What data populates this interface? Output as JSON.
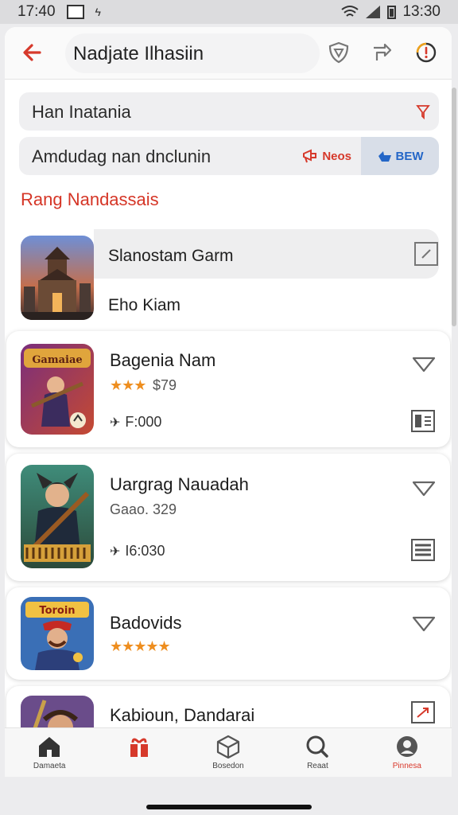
{
  "status_bar": {
    "time_left": "17:40",
    "time_right": "13:30"
  },
  "header": {
    "title": "Nadjate Ilhasiin"
  },
  "filters": {
    "dropdown_label": "Han Inatania",
    "toggle_label": "Amdudag nan dnclunin",
    "news_label": "Neos",
    "new_label": "BEW"
  },
  "section": {
    "title": "Rang Nandassais"
  },
  "featured": {
    "title": "Slanostam Garm",
    "subtitle": "Eho Kiam"
  },
  "games": [
    {
      "title": "Bagenia Nam",
      "rating": 3,
      "rating_text": "$79",
      "stat": "F:000"
    },
    {
      "title": "Uargrag Nauadah",
      "subtitle": "Gaao. 329",
      "stat": "I6:030"
    },
    {
      "title": "Badovids",
      "rating": 5
    },
    {
      "title": "Kabioun, Dandarai"
    }
  ],
  "thumb_labels": {
    "game1": "Gamaiae",
    "game3": "Toroin"
  },
  "nav": [
    {
      "label": "Damaeta",
      "icon": "home-icon"
    },
    {
      "label": "",
      "icon": "gift-icon"
    },
    {
      "label": "Bosedon",
      "icon": "cube-icon"
    },
    {
      "label": "Reaat",
      "icon": "search-icon"
    },
    {
      "label": "Pinnesa",
      "icon": "profile-icon"
    }
  ],
  "colors": {
    "accent": "#d6392b",
    "blue": "#2466c7",
    "star": "#ee8e1f"
  }
}
